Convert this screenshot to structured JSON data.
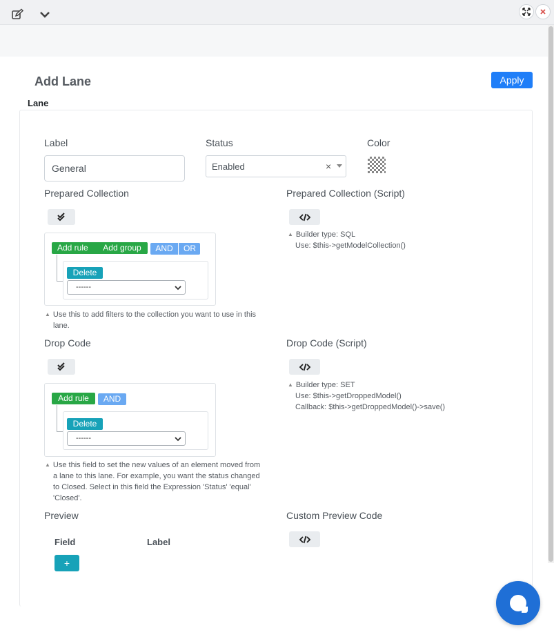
{
  "window": {
    "expand_icon": "expand-arrows-icon",
    "close_icon": "close-icon"
  },
  "toolbar": {
    "edit_icon": "edit-icon",
    "collapse_icon": "chevron-down-icon"
  },
  "page": {
    "title": "Add Lane",
    "apply_label": "Apply",
    "section_label": "Lane"
  },
  "form": {
    "label_field": {
      "label": "Label",
      "value": "General"
    },
    "status_field": {
      "label": "Status",
      "value": "Enabled",
      "clear": "×"
    },
    "color_field": {
      "label": "Color"
    }
  },
  "prepared_collection": {
    "label": "Prepared Collection",
    "add_rule": "Add rule",
    "add_group": "Add group",
    "and": "AND",
    "or": "OR",
    "delete": "Delete",
    "rule_value": "------",
    "help": [
      "Use this to add filters to the collection you want to use in this",
      "lane."
    ]
  },
  "prepared_collection_script": {
    "label": "Prepared Collection (Script)",
    "help": [
      "Builder type: SQL",
      "Use: $this->getModelCollection()"
    ]
  },
  "drop_code": {
    "label": "Drop Code",
    "add_rule": "Add rule",
    "and": "AND",
    "delete": "Delete",
    "rule_value": "------",
    "help": [
      "Use this field to set the new values of an element moved from",
      "a lane to this lane. For example, you want the status changed",
      "to Closed. Select in this field the Expression 'Status' 'equal'",
      "'Closed'."
    ]
  },
  "drop_code_script": {
    "label": "Drop Code (Script)",
    "help": [
      "Builder type: SET",
      "Use: $this->getDroppedModel()",
      "Callback: $this->getDroppedModel()->save()"
    ]
  },
  "preview": {
    "label": "Preview",
    "col_field": "Field",
    "col_label": "Label",
    "add_label": "+"
  },
  "custom_preview": {
    "label": "Custom Preview Code"
  },
  "colors": {
    "primary": "#1f7ef8",
    "green": "#28a745",
    "blue": "#6aa9f2",
    "teal": "#17a2b8",
    "chat": "#1f6fd6"
  }
}
